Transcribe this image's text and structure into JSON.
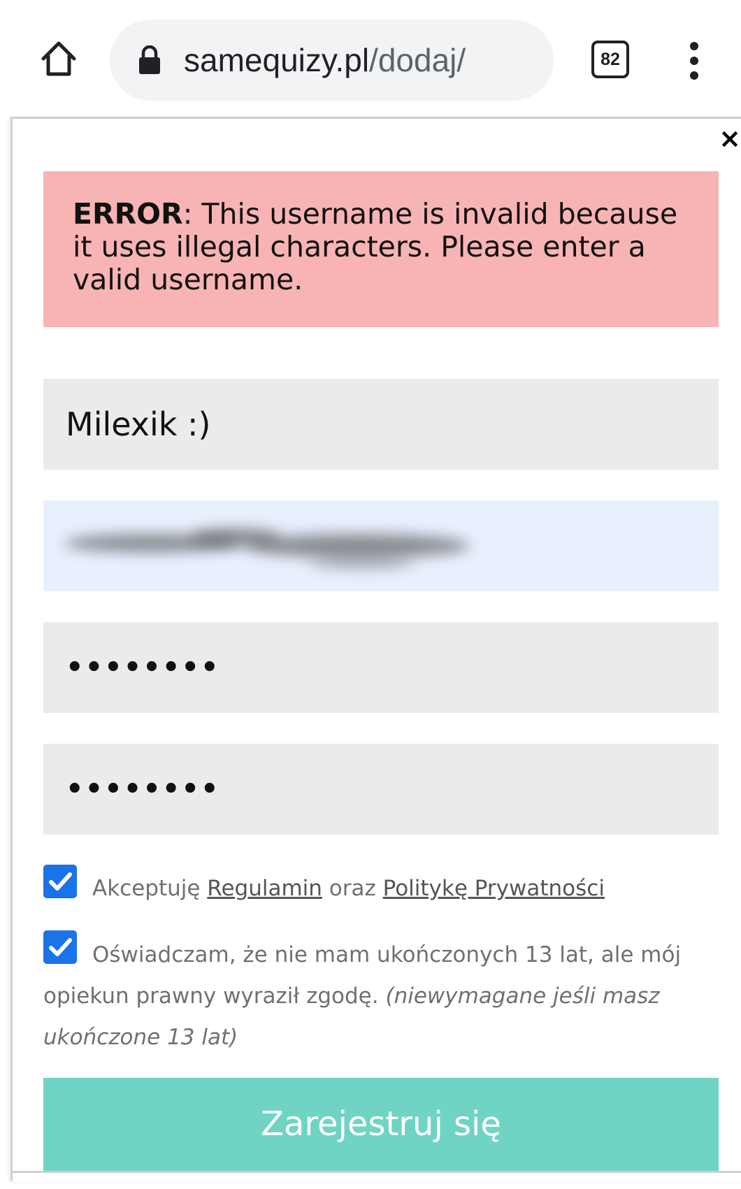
{
  "browser": {
    "url_host": "samequizy.pl",
    "url_path": "/dodaj/",
    "tab_count": "82",
    "icons": [
      "home-icon",
      "lock-icon",
      "tabs-icon",
      "more-vert-icon"
    ]
  },
  "modal": {
    "close_label": "×",
    "error": {
      "prefix": "ERROR",
      "message": ": This username is invalid because it uses illegal characters. Please enter a valid username."
    },
    "fields": {
      "username_value": "Milexik :)",
      "password_value": "••••••••",
      "password_confirm_value": "••••••••"
    },
    "consent_terms": {
      "checked": true,
      "text_before": "Akceptuję ",
      "link_terms": "Regulamin",
      "text_middle": " oraz ",
      "link_privacy": "Politykę Prywatności"
    },
    "consent_age": {
      "checked": true,
      "text": "Oświadczam, że nie mam ukończonych 13 lat, ale mój opiekun prawny wyraził zgodę.",
      "note": "(niewymagane jeśli masz ukończone 13 lat)"
    },
    "submit_label": "Zarejestruj się"
  },
  "colors": {
    "error_bg": "#f8b4b4",
    "field_bg": "#ebebeb",
    "autofill_bg": "#e8f0fe",
    "checkbox": "#1a73e8",
    "submit_bg": "#6fd4c3"
  }
}
